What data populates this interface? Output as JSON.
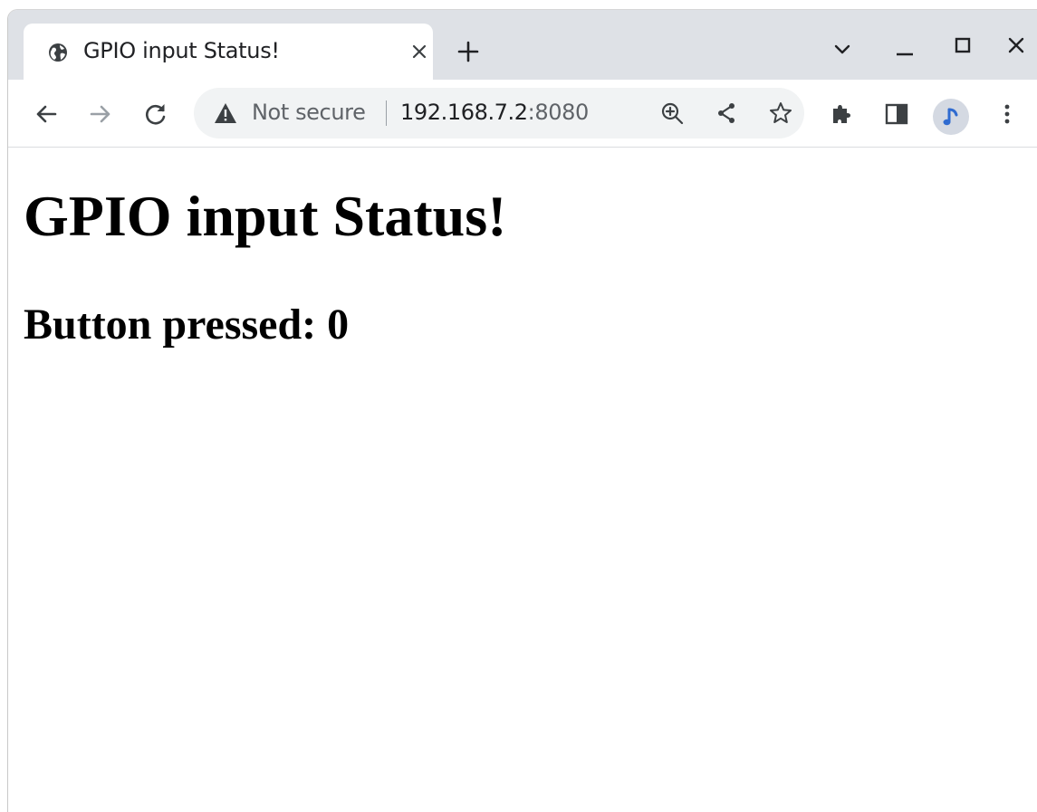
{
  "tab": {
    "title": "GPIO input Status!",
    "favicon": "globe-icon"
  },
  "omnibox": {
    "security_label": "Not secure",
    "url_host": "192.168.7.2",
    "url_port": ":8080"
  },
  "page": {
    "heading": "GPIO input Status!",
    "status_line": "Button pressed: 0"
  },
  "colors": {
    "tabstrip": "#dee1e6",
    "omnibox_bg": "#f1f3f4",
    "icon": "#5f6368",
    "avatar_accent": "#2f6bd0"
  }
}
